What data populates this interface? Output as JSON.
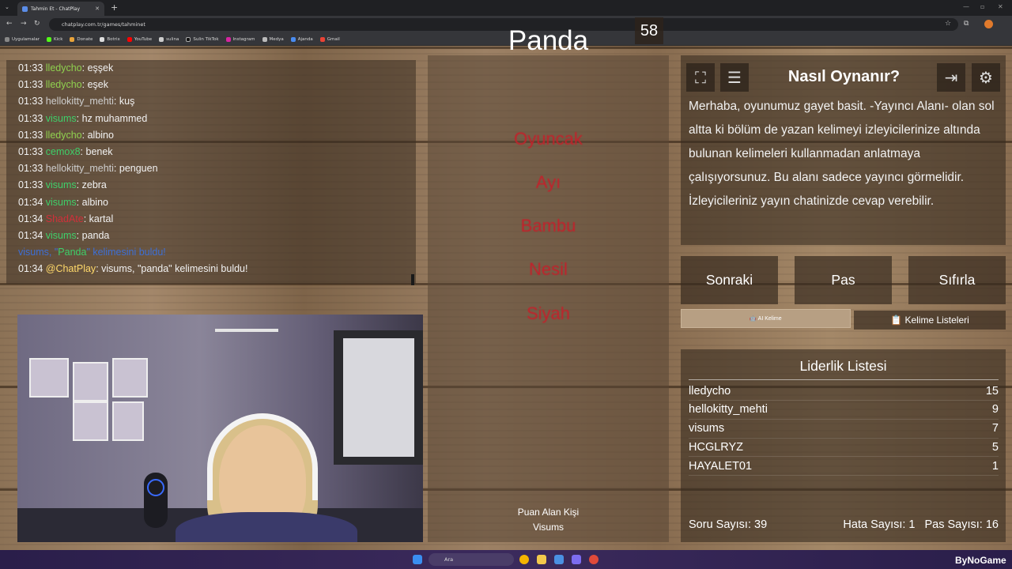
{
  "browser": {
    "tab_title": "Tahmin Et - ChatPlay",
    "url": "chatplay.com.tr/games/tahminet",
    "bookmarks": [
      "Uygulamalar",
      "Kick",
      "Donate",
      "Botrix",
      "YouTube",
      "sulina",
      "Sulin TikTok",
      "Instagram",
      "Medya",
      "Ajanda",
      "Gmail"
    ]
  },
  "chat": {
    "messages": [
      {
        "time": "01:33",
        "user": "lledycho",
        "user_color": "#8fd14f",
        "text": ": eşşek"
      },
      {
        "time": "01:33",
        "user": "lledycho",
        "user_color": "#8fd14f",
        "text": ": eşek"
      },
      {
        "time": "01:33",
        "user": "hellokitty_mehti",
        "user_color": "#cfcfcf",
        "text": ": kuş"
      },
      {
        "time": "01:33",
        "user": "visums",
        "user_color": "#3ed06a",
        "text": ": hz muhammed"
      },
      {
        "time": "01:33",
        "user": "lledycho",
        "user_color": "#8fd14f",
        "text": ": albino"
      },
      {
        "time": "01:33",
        "user": "cemox8",
        "user_color": "#3ed06a",
        "text": ": benek"
      },
      {
        "time": "01:33",
        "user": "hellokitty_mehti",
        "user_color": "#cfcfcf",
        "text": ": penguen"
      },
      {
        "time": "01:33",
        "user": "visums",
        "user_color": "#3ed06a",
        "text": ": zebra"
      },
      {
        "time": "01:34",
        "user": "visums",
        "user_color": "#3ed06a",
        "text": ": albino"
      },
      {
        "time": "01:34",
        "user": "ShadAte",
        "user_color": "#d0303a",
        "text": ": kartal"
      },
      {
        "time": "01:34",
        "user": "visums",
        "user_color": "#3ed06a",
        "text": ": panda"
      }
    ],
    "found_notice": {
      "prefix": "visums, \"",
      "word": "Panda",
      "suffix": "\" kelimesini buldu!"
    },
    "bot_line": {
      "time": "01:34",
      "user": "@ChatPlay",
      "text": ": visums, \"panda\" kelimesini buldu!"
    }
  },
  "game": {
    "timer": "58",
    "target_word": "Panda",
    "forbidden_words": [
      "Oyuncak",
      "Ayı",
      "Bambu",
      "Nesil",
      "Siyah"
    ],
    "scorer_label": "Puan Alan Kişi",
    "scorer_name": "Visums"
  },
  "howto": {
    "title": "Nasıl Oynanır?",
    "text": "Merhaba, oyunumuz gayet basit. -Yayıncı Alanı- olan sol altta ki bölüm de yazan kelimeyi izleyicilerinize altında bulunan kelimeleri kullanmadan anlatmaya çalışıyorsunuz. Bu alanı sadece yayıncı görmelidir. İzleyicileriniz yayın chatinizde cevap verebilir."
  },
  "controls": {
    "next": "Sonraki",
    "pass": "Pas",
    "reset": "Sıfırla",
    "ai_words": "🤖 AI Kelime",
    "word_lists": "📋 Kelime Listeleri"
  },
  "leaderboard": {
    "title": "Liderlik Listesi",
    "rows": [
      {
        "name": "lledycho",
        "score": "15"
      },
      {
        "name": "hellokitty_mehti",
        "score": "9"
      },
      {
        "name": "visums",
        "score": "7"
      },
      {
        "name": "HCGLRYZ",
        "score": "5"
      },
      {
        "name": "HAYALET01",
        "score": "1"
      }
    ]
  },
  "stats": {
    "questions": "Soru Sayısı: 39",
    "errors": "Hata Sayısı: 1",
    "passes": "Pas Sayısı: 16"
  },
  "taskbar": {
    "search_placeholder": "Ara",
    "watermark": "ByNoGame"
  }
}
